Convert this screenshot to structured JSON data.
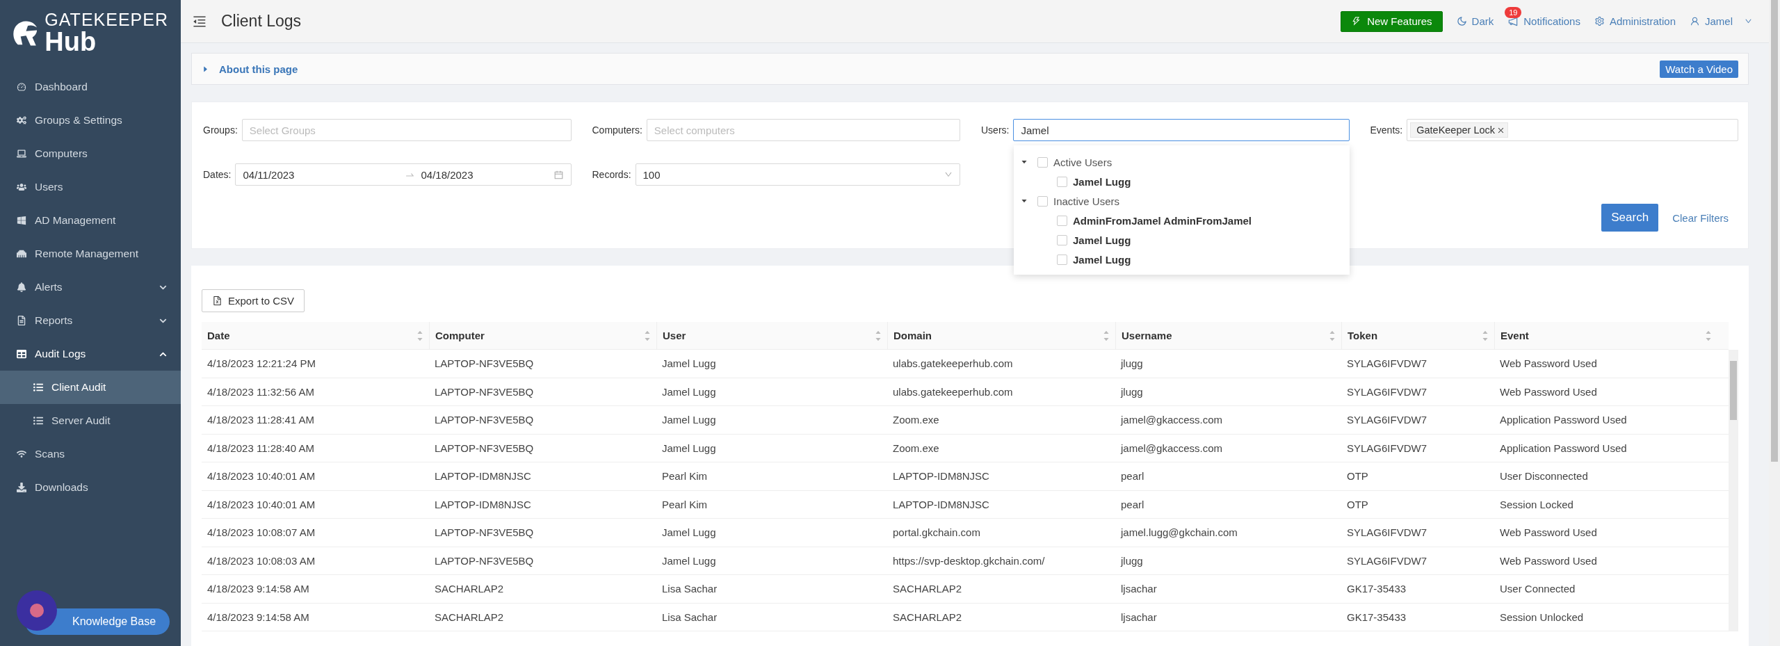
{
  "logo": {
    "line_1": "GATEKEEPER",
    "line_2": "Hub"
  },
  "sidebar": {
    "items": [
      {
        "label": "Dashboard",
        "kind": "link"
      },
      {
        "label": "Groups & Settings",
        "kind": "link"
      },
      {
        "label": "Computers",
        "kind": "link"
      },
      {
        "label": "Users",
        "kind": "link"
      },
      {
        "label": "AD Management",
        "kind": "link"
      },
      {
        "label": "Remote Management",
        "kind": "link"
      },
      {
        "label": "Alerts",
        "kind": "group",
        "expanded": false
      },
      {
        "label": "Reports",
        "kind": "group",
        "expanded": false
      },
      {
        "label": "Audit Logs",
        "kind": "group",
        "expanded": true,
        "children": [
          {
            "label": "Client Audit",
            "selected": true
          },
          {
            "label": "Server Audit",
            "selected": false
          }
        ]
      },
      {
        "label": "Scans",
        "kind": "link"
      },
      {
        "label": "Downloads",
        "kind": "link"
      }
    ],
    "knowledge_base": "Knowledge Base"
  },
  "header": {
    "title": "Client Logs",
    "new_features": "New Features",
    "theme": "Dark",
    "notifications": {
      "label": "Notifications",
      "count": "19"
    },
    "administration": "Administration",
    "user": "Jamel"
  },
  "about": {
    "label": "About this page",
    "expanded": false,
    "video_button": "Watch a Video"
  },
  "filters": {
    "fields": [
      {
        "kind": "select",
        "label": "Groups:",
        "placeholder": "Select Groups"
      },
      {
        "kind": "select",
        "label": "Computers:",
        "placeholder": "Select computers"
      },
      {
        "kind": "search",
        "label": "Users:",
        "value": "Jamel",
        "focused": true
      },
      {
        "kind": "tags",
        "label": "Events:",
        "tags": [
          "GateKeeper Lock"
        ]
      },
      {
        "kind": "daterange",
        "label": "Dates:",
        "start": "04/11/2023",
        "end": "04/18/2023"
      },
      {
        "kind": "dropdown",
        "label": "Records:",
        "value": "100"
      }
    ],
    "search_button": "Search",
    "clear_button": "Clear Filters",
    "user_options": [
      {
        "label": "Active Users",
        "expanded": true,
        "checked": false,
        "children": [
          {
            "label": "Jamel Lugg",
            "checked": false
          }
        ]
      },
      {
        "label": "Inactive Users",
        "expanded": true,
        "checked": false,
        "children": [
          {
            "label": "AdminFromJamel AdminFromJamel",
            "checked": false
          },
          {
            "label": "Jamel Lugg",
            "checked": false
          },
          {
            "label": "Jamel Lugg",
            "checked": false
          }
        ]
      }
    ]
  },
  "export_button": "Export to CSV",
  "table": {
    "columns": [
      "Date",
      "Computer",
      "User",
      "Domain",
      "Username",
      "Token",
      "Event"
    ],
    "rows": [
      [
        "4/18/2023 12:21:24 PM",
        "LAPTOP-NF3VE5BQ",
        "Jamel Lugg",
        "ulabs.gatekeeperhub.com",
        "jlugg",
        "SYLAG6IFVDW7",
        "Web Password Used"
      ],
      [
        "4/18/2023 11:32:56 AM",
        "LAPTOP-NF3VE5BQ",
        "Jamel Lugg",
        "ulabs.gatekeeperhub.com",
        "jlugg",
        "SYLAG6IFVDW7",
        "Web Password Used"
      ],
      [
        "4/18/2023 11:28:41 AM",
        "LAPTOP-NF3VE5BQ",
        "Jamel Lugg",
        "Zoom.exe",
        "jamel@gkaccess.com",
        "SYLAG6IFVDW7",
        "Application Password Used"
      ],
      [
        "4/18/2023 11:28:40 AM",
        "LAPTOP-NF3VE5BQ",
        "Jamel Lugg",
        "Zoom.exe",
        "jamel@gkaccess.com",
        "SYLAG6IFVDW7",
        "Application Password Used"
      ],
      [
        "4/18/2023 10:40:01 AM",
        "LAPTOP-IDM8NJSC",
        "Pearl Kim",
        "LAPTOP-IDM8NJSC",
        "pearl",
        "OTP",
        "User Disconnected"
      ],
      [
        "4/18/2023 10:40:01 AM",
        "LAPTOP-IDM8NJSC",
        "Pearl Kim",
        "LAPTOP-IDM8NJSC",
        "pearl",
        "OTP",
        "Session Locked"
      ],
      [
        "4/18/2023 10:08:07 AM",
        "LAPTOP-NF3VE5BQ",
        "Jamel Lugg",
        "portal.gkchain.com",
        "jamel.lugg@gkchain.com",
        "SYLAG6IFVDW7",
        "Web Password Used"
      ],
      [
        "4/18/2023 10:08:03 AM",
        "LAPTOP-NF3VE5BQ",
        "Jamel Lugg",
        "https://svp-desktop.gkchain.com/",
        "jlugg",
        "SYLAG6IFVDW7",
        "Web Password Used"
      ],
      [
        "4/18/2023 9:14:58 AM",
        "SACHARLAP2",
        "Lisa Sachar",
        "SACHARLAP2",
        "ljsachar",
        "GK17-35433",
        "User Connected"
      ],
      [
        "4/18/2023 9:14:58 AM",
        "SACHARLAP2",
        "Lisa Sachar",
        "SACHARLAP2",
        "ljsachar",
        "GK17-35433",
        "Session Unlocked"
      ]
    ]
  }
}
